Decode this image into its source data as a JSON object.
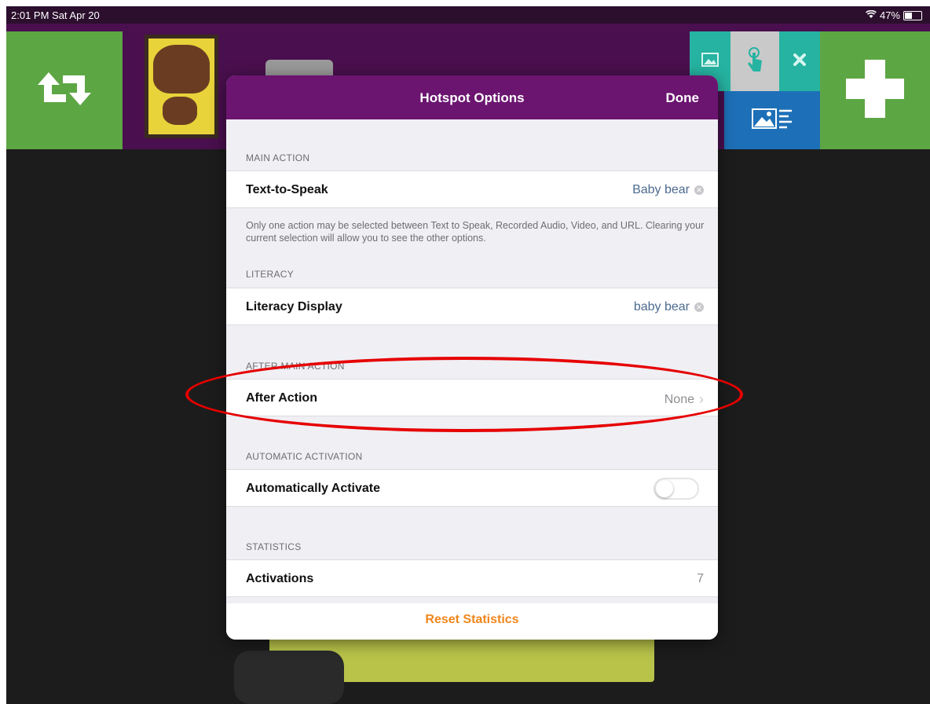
{
  "status_bar": {
    "time": "2:01 PM  Sat Apr 20",
    "battery": "47%",
    "battery_fraction": 0.47
  },
  "toolbar": {
    "icons": [
      "repeat-icon",
      "book-cover-thumbnail",
      "image-crop-icon",
      "hand-pointer-icon",
      "close-icon",
      "image-text-icon",
      "plus-icon"
    ]
  },
  "popover": {
    "title": "Hotspot Options",
    "done_label": "Done",
    "main_action": {
      "section_label": "MAIN ACTION",
      "row_label": "Text-to-Speak",
      "row_value": "Baby bear",
      "note": "Only one action may be selected between Text to Speak, Recorded Audio, Video, and URL.  Clearing your current selection will allow you to see the other options."
    },
    "literacy": {
      "section_label": "LITERACY",
      "row_label": "Literacy Display",
      "row_value": "baby bear"
    },
    "after_main_action": {
      "section_label": "AFTER MAIN ACTION",
      "row_label": "After Action",
      "row_value": "None",
      "chevron": "›"
    },
    "automatic_activation": {
      "section_label": "AUTOMATIC ACTIVATION",
      "row_label": "Automatically Activate",
      "toggle_on": false
    },
    "statistics": {
      "section_label": "STATISTICS",
      "row_label": "Activations",
      "row_value": "7",
      "reset_label": "Reset Statistics"
    }
  },
  "colors": {
    "header_purple": "#6b1570",
    "toolbar_purple": "#4a0f4e",
    "green_tile": "#5da644",
    "teal_tile": "#26b3a1",
    "blue_tile": "#1d70b7",
    "reset_orange": "#f0861c",
    "annotation_red": "#e60000"
  }
}
